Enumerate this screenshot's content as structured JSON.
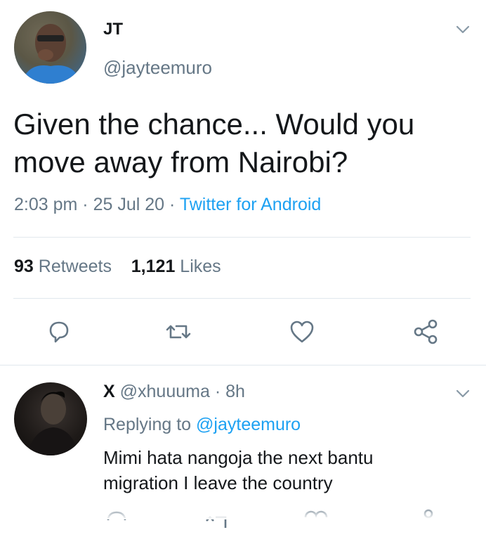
{
  "tweet": {
    "name": "JT",
    "handle": "@jayteemuro",
    "text": "Given the chance... Would you move away from Nairobi?",
    "time": "2:03 pm",
    "date": "25 Jul 20",
    "source": "Twitter for Android",
    "retweets": "93",
    "retweets_label": "Retweets",
    "likes": "1,121",
    "likes_label": "Likes"
  },
  "reply": {
    "name": "X",
    "handle": "@xhuuuma",
    "age": "8h",
    "replying_prefix": "Replying to",
    "replying_to": "@jayteemuro",
    "text": "Mimi hata nangoja the next bantu migration I leave the country"
  },
  "icons": {
    "reply": "reply-icon",
    "retweet": "retweet-icon",
    "like": "heart-icon",
    "share": "share-icon",
    "menu": "chevron-down-icon"
  },
  "colors": {
    "link": "#1da1f2",
    "muted": "#657786",
    "divider": "#e1e8ed"
  }
}
